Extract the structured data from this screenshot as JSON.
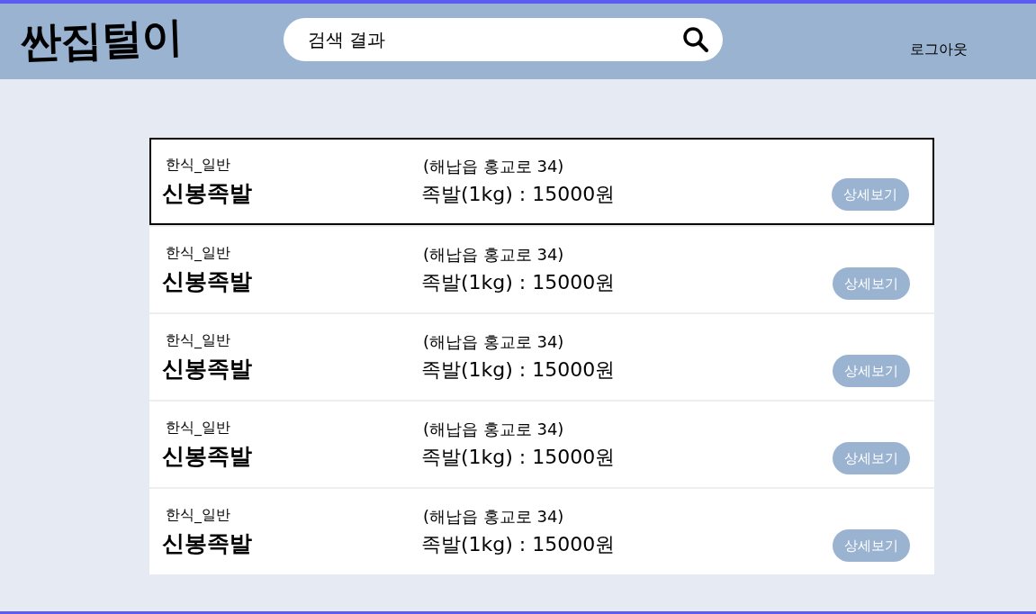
{
  "header": {
    "logo": "싼집털이",
    "search": {
      "value": "검색 결과"
    },
    "logout": "로그아웃"
  },
  "results": [
    {
      "category": "한식_일반",
      "name": "신봉족발",
      "address": "(해납읍 홍교로 34)",
      "menu": "족발(1kg) : 15000원",
      "button": "상세보기",
      "selected": true
    },
    {
      "category": "한식_일반",
      "name": "신봉족발",
      "address": "(해납읍 홍교로 34)",
      "menu": "족발(1kg) : 15000원",
      "button": "상세보기",
      "selected": false
    },
    {
      "category": "한식_일반",
      "name": "신봉족발",
      "address": "(해납읍 홍교로 34)",
      "menu": "족발(1kg) : 15000원",
      "button": "상세보기",
      "selected": false
    },
    {
      "category": "한식_일반",
      "name": "신봉족발",
      "address": "(해납읍 홍교로 34)",
      "menu": "족발(1kg) : 15000원",
      "button": "상세보기",
      "selected": false
    },
    {
      "category": "한식_일반",
      "name": "신봉족발",
      "address": "(해납읍 홍교로 34)",
      "menu": "족발(1kg) : 15000원",
      "button": "상세보기",
      "selected": false
    }
  ]
}
